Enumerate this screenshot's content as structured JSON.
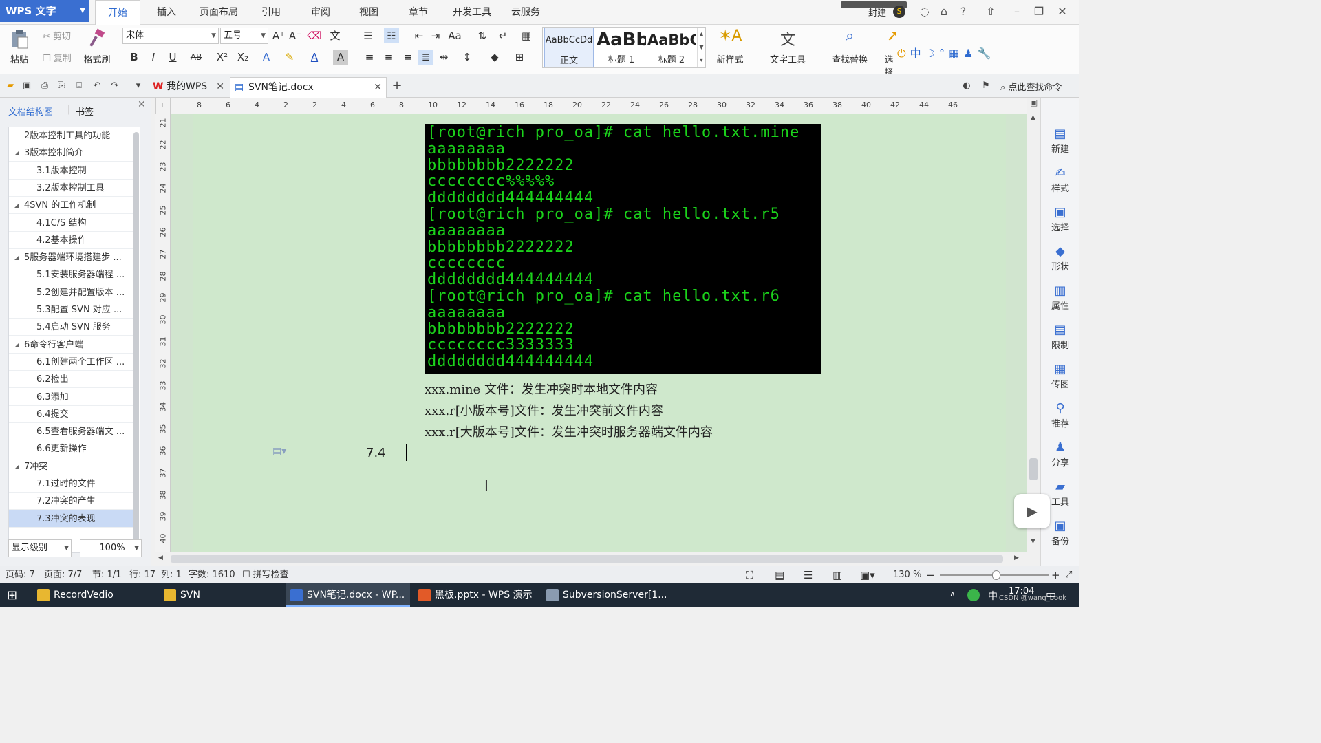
{
  "app": {
    "name": "WPS 文字"
  },
  "menu": {
    "tabs": [
      "开始",
      "插入",
      "页面布局",
      "引用",
      "审阅",
      "视图",
      "章节",
      "开发工具",
      "云服务"
    ],
    "active": "开始",
    "account": "封建"
  },
  "ribbon": {
    "paste": "粘贴",
    "cut": "剪切",
    "copy": "复制",
    "format_painter": "格式刷",
    "font": "宋体",
    "size": "五号",
    "styles": [
      {
        "preview": "AaBbCcDd",
        "label": "正文"
      },
      {
        "preview": "AaBb",
        "label": "标题 1"
      },
      {
        "preview": "AaBbC",
        "label": "标题 2"
      }
    ],
    "new_style": "新样式",
    "text_tools": "文字工具",
    "find_replace": "查找替换",
    "select": "选择"
  },
  "doc_tabs": [
    {
      "label": "我的WPS"
    },
    {
      "label": "SVN笔记.docx",
      "active": true
    }
  ],
  "search_command": "点此查找命令",
  "nav": {
    "tab_outline": "文档结构图",
    "tab_bookmark": "书签",
    "items": [
      {
        "label": "2版本控制工具的功能",
        "level": 1
      },
      {
        "label": "3版本控制简介",
        "level": 1,
        "expanded": true
      },
      {
        "label": "3.1版本控制",
        "level": 2
      },
      {
        "label": "3.2版本控制工具",
        "level": 2
      },
      {
        "label": "4SVN 的工作机制",
        "level": 1,
        "expanded": true
      },
      {
        "label": "4.1C/S 结构",
        "level": 2
      },
      {
        "label": "4.2基本操作",
        "level": 2
      },
      {
        "label": "5服务器端环境搭建步 ...",
        "level": 1,
        "expanded": true
      },
      {
        "label": "5.1安装服务器端程 ...",
        "level": 2
      },
      {
        "label": "5.2创建并配置版本 ...",
        "level": 2
      },
      {
        "label": "5.3配置 SVN 对应 ...",
        "level": 2
      },
      {
        "label": "5.4启动 SVN 服务",
        "level": 2
      },
      {
        "label": "6命令行客户端",
        "level": 1,
        "expanded": true
      },
      {
        "label": "6.1创建两个工作区 ...",
        "level": 2
      },
      {
        "label": "6.2检出",
        "level": 2
      },
      {
        "label": "6.3添加",
        "level": 2
      },
      {
        "label": "6.4提交",
        "level": 2
      },
      {
        "label": "6.5查看服务器端文 ...",
        "level": 2
      },
      {
        "label": "6.6更新操作",
        "level": 2
      },
      {
        "label": "7冲突",
        "level": 1,
        "expanded": true
      },
      {
        "label": "7.1过时的文件",
        "level": 2
      },
      {
        "label": "7.2冲突的产生",
        "level": 2
      },
      {
        "label": "7.3冲突的表现",
        "level": 2,
        "selected": true
      }
    ],
    "display_level": "显示级别",
    "zoom": "100%"
  },
  "ruler": {
    "h": [
      "8",
      "6",
      "4",
      "2",
      "2",
      "4",
      "6",
      "8",
      "10",
      "12",
      "14",
      "16",
      "18",
      "20",
      "22",
      "24",
      "26",
      "28",
      "30",
      "32",
      "34",
      "36",
      "38",
      "40",
      "42",
      "44",
      "46"
    ],
    "v": [
      "21",
      "22",
      "23",
      "24",
      "25",
      "26",
      "27",
      "28",
      "29",
      "30",
      "31",
      "32",
      "33",
      "34",
      "35",
      "36",
      "37",
      "38",
      "39",
      "40"
    ]
  },
  "terminal": {
    "lines": [
      "[root@rich pro_oa]# cat hello.txt.mine",
      "aaaaaaaa",
      "bbbbbbbb2222222",
      "cccccccc%%%%%",
      "dddddddd444444444",
      "[root@rich pro_oa]# cat hello.txt.r5",
      "aaaaaaaa",
      "bbbbbbbb2222222",
      "cccccccc",
      "dddddddd444444444",
      "[root@rich pro_oa]# cat hello.txt.r6",
      "aaaaaaaa",
      "bbbbbbbb2222222",
      "cccccccc3333333",
      "dddddddd444444444"
    ]
  },
  "document": {
    "lines": [
      "xxx.mine 文件：发生冲突时本地文件内容",
      "xxx.r[小版本号]文件：发生冲突前文件内容",
      "xxx.r[大版本号]文件：发生冲突时服务器端文件内容"
    ],
    "heading_number": "7.4"
  },
  "right_panel": [
    "新建",
    "样式",
    "选择",
    "形状",
    "属性",
    "限制",
    "传图",
    "推荐",
    "分享",
    "工具",
    "备份"
  ],
  "status": {
    "page_num": "页码: 7",
    "page": "页面: 7/7",
    "section": "节: 1/1",
    "row": "行: 17",
    "col": "列: 1",
    "words": "字数: 1610",
    "spell": "拼写检查",
    "zoom": "130 %"
  },
  "taskbar": {
    "items": [
      "RecordVedio",
      "SVN",
      "SVN笔记.docx - WP...",
      "黑板.pptx - WPS 演示",
      "SubversionServer[1..."
    ],
    "ime": "中",
    "time": "17:04",
    "watermark": "CSDN @wang_book"
  },
  "colors": {
    "accent": "#3a6fd1",
    "doc_bg": "#cfe8cc",
    "terminal_text": "#1bd21b",
    "taskbar": "#1f2a36"
  }
}
